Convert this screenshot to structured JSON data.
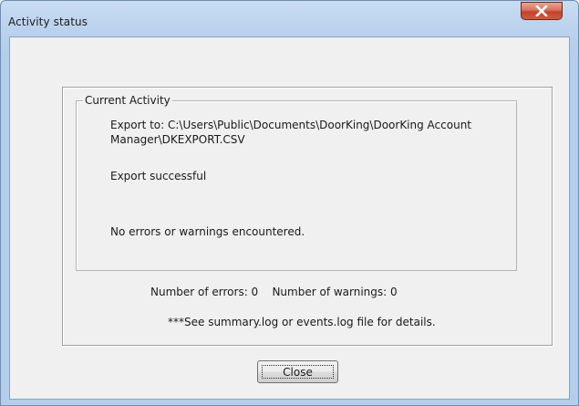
{
  "window": {
    "title": "Activity status"
  },
  "titlebar": {
    "close_icon": "close-x-icon",
    "close_color": "#c7472c"
  },
  "activity": {
    "group_label": "Current Activity",
    "export_line1": "Export to: C:\\Users\\Public\\Documents\\DoorKing\\DoorKing Account",
    "export_line2": "Manager\\DKEXPORT.CSV",
    "status": "Export successful",
    "errors_message": "No errors or warnings encountered."
  },
  "summary": {
    "counts": "Number of errors: 0    Number of warnings: 0",
    "log_note": "***See summary.log or events.log file for details."
  },
  "buttons": {
    "close_label": "Close"
  }
}
